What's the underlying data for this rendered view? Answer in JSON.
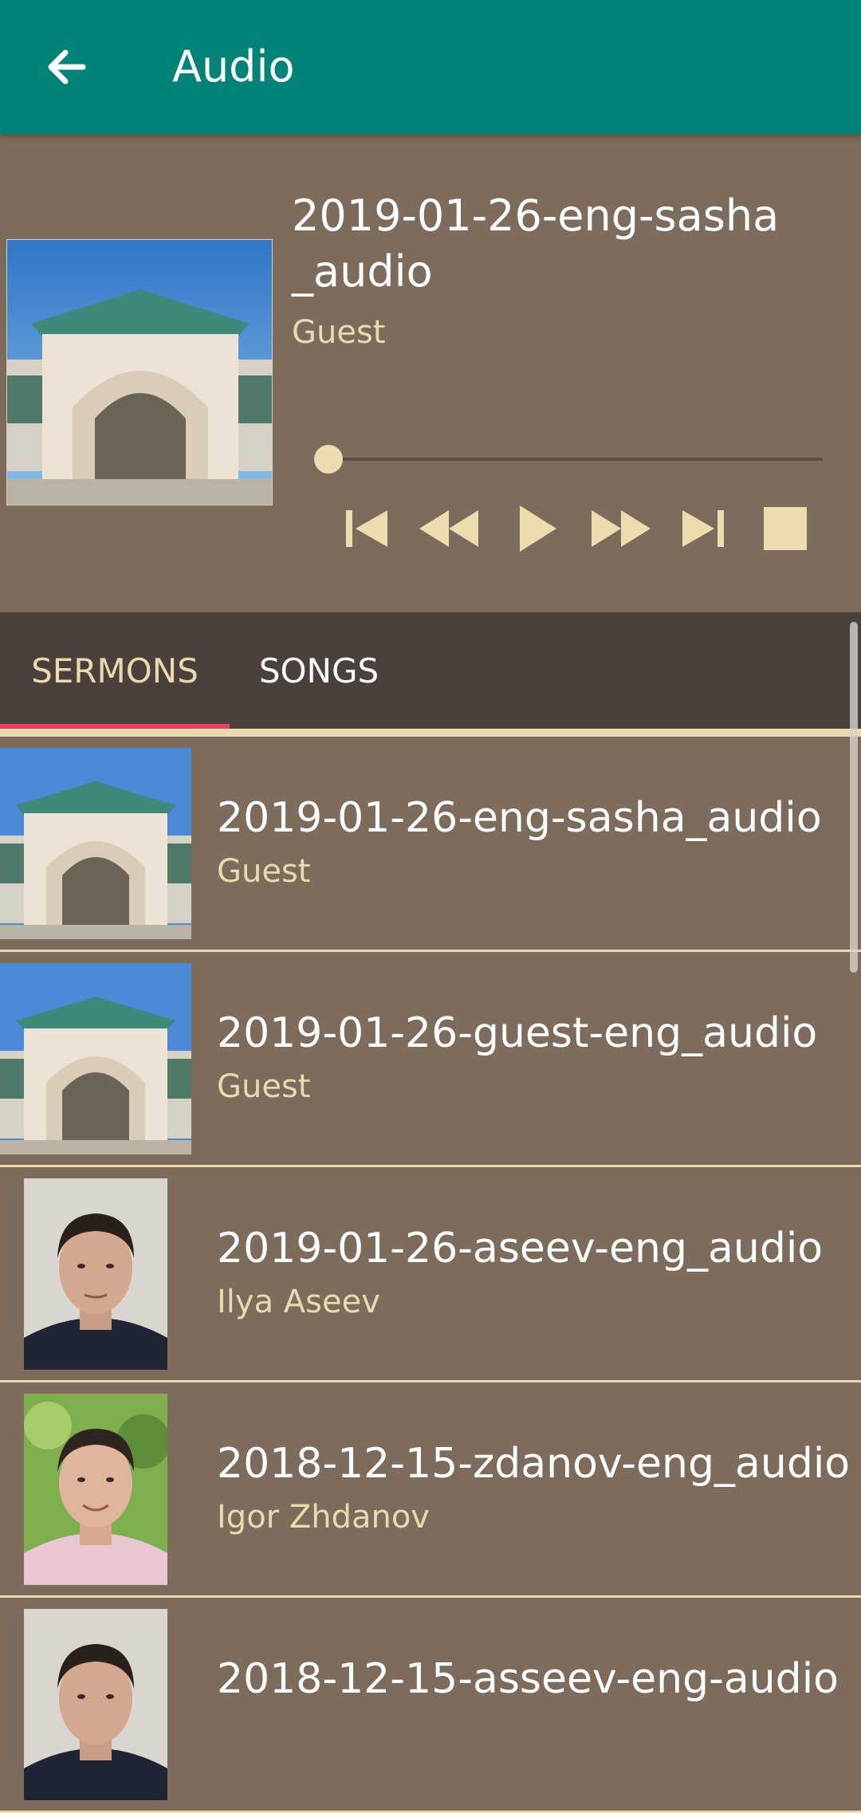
{
  "appbar": {
    "title": "Audio",
    "back_icon": "arrow-left-icon",
    "color": "#018477"
  },
  "player": {
    "title": "2019-01-26-eng-sasha_audio",
    "title_line1": "2019-01-26-eng-sasha",
    "title_line2": "_audio",
    "artist": "Guest",
    "progress": 0,
    "controls": [
      "skip-previous-icon",
      "rewind-icon",
      "play-icon",
      "fast-forward-icon",
      "skip-next-icon",
      "stop-icon"
    ]
  },
  "tabs": [
    {
      "label": "SERMONS",
      "selected": true
    },
    {
      "label": "SONGS",
      "selected": false
    }
  ],
  "colors": {
    "background": "#7d6b5b",
    "accent": "#e9d9ae",
    "tab_indicator": "#ec3d5c",
    "tabbar": "#4b413c"
  },
  "list": [
    {
      "title": "2019-01-26-eng-sasha_audio",
      "artist": "Guest",
      "thumb": "building"
    },
    {
      "title": "2019-01-26-guest-eng_audio",
      "artist": "Guest",
      "thumb": "building"
    },
    {
      "title": "2019-01-26-aseev-eng_audio",
      "artist": "Ilya Aseev",
      "thumb": "person-dark"
    },
    {
      "title": "2018-12-15-zdanov-eng_audio",
      "artist": "Igor Zhdanov",
      "thumb": "person-light"
    },
    {
      "title": "2018-12-15-asseev-eng-audio",
      "artist": "",
      "thumb": "person-dark"
    }
  ]
}
